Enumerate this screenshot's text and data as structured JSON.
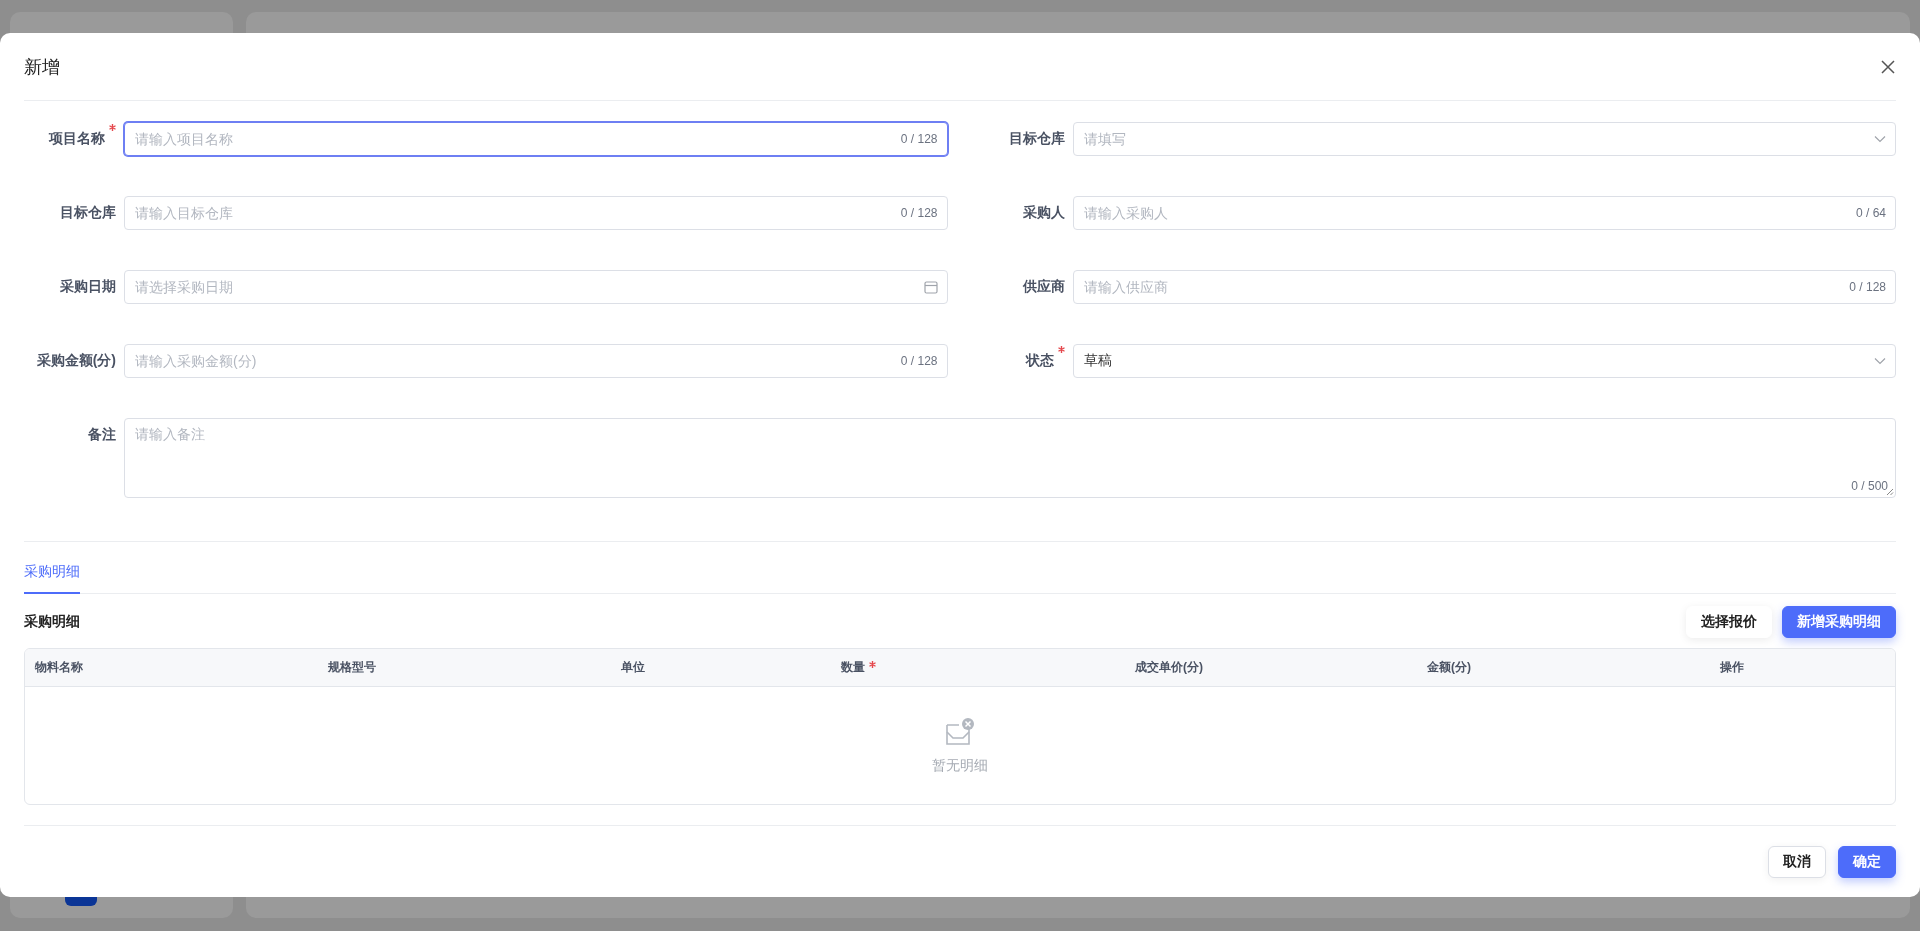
{
  "dialog": {
    "title": "新增"
  },
  "form_rows": [
    {
      "fields": [
        {
          "label": "项目名称",
          "required": true,
          "kind": "text",
          "placeholder": "请输入项目名称",
          "counter": "0 / 128",
          "focused": true
        },
        {
          "label": "目标仓库",
          "required": false,
          "kind": "select",
          "placeholder": "请填写",
          "focused": false
        }
      ]
    },
    {
      "fields": [
        {
          "label": "目标仓库",
          "required": false,
          "kind": "text",
          "placeholder": "请输入目标仓库",
          "counter": "0 / 128",
          "focused": false
        },
        {
          "label": "采购人",
          "required": false,
          "kind": "text",
          "placeholder": "请输入采购人",
          "counter": "0 / 64",
          "focused": false
        }
      ]
    },
    {
      "fields": [
        {
          "label": "采购日期",
          "required": false,
          "kind": "date",
          "placeholder": "请选择采购日期",
          "focused": false
        },
        {
          "label": "供应商",
          "required": false,
          "kind": "text",
          "placeholder": "请输入供应商",
          "counter": "0 / 128",
          "focused": false
        }
      ]
    },
    {
      "fields": [
        {
          "label": "采购金额(分)",
          "required": false,
          "kind": "text",
          "placeholder": "请输入采购金额(分)",
          "counter": "0 / 128",
          "focused": false
        },
        {
          "label": "状态",
          "required": true,
          "kind": "select",
          "value": "草稿",
          "focused": false
        }
      ]
    },
    {
      "fields": [
        {
          "label": "备注",
          "required": false,
          "kind": "textarea",
          "placeholder": "请输入备注",
          "counter": "0 / 500",
          "focused": false
        }
      ]
    }
  ],
  "tabs": [
    {
      "label": "采购明细",
      "selected": true
    }
  ],
  "detail": {
    "title": "采购明细",
    "buttons": [
      {
        "label": "选择报价",
        "kind": "secondary"
      },
      {
        "label": "新增采购明细",
        "kind": "primary"
      }
    ],
    "table": {
      "columns": [
        {
          "label": "物料名称",
          "required": false
        },
        {
          "label": "规格型号",
          "required": false
        },
        {
          "label": "单位",
          "required": false
        },
        {
          "label": "数量",
          "required": true
        },
        {
          "label": "成交单价(分)",
          "required": false
        },
        {
          "label": "金额(分)",
          "required": false
        },
        {
          "label": "操作",
          "required": false
        }
      ],
      "empty_text": "暂无明细"
    }
  },
  "footer_buttons": [
    {
      "label": "取消",
      "kind": "default"
    },
    {
      "label": "确定",
      "kind": "primary"
    }
  ]
}
